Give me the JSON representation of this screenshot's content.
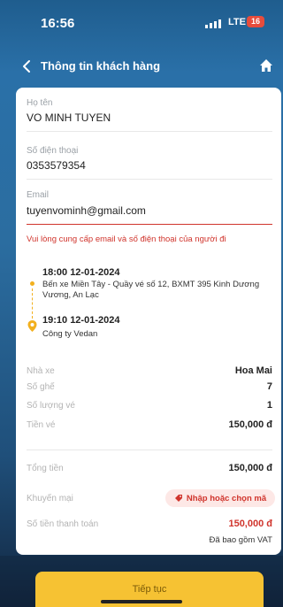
{
  "status_bar": {
    "time": "16:56",
    "network": "LTE",
    "battery": "16"
  },
  "nav": {
    "title": "Thông tin khách hàng"
  },
  "form": {
    "name_label": "Họ tên",
    "name_value": "VO MINH TUYEN",
    "phone_label": "Số điện thoại",
    "phone_value": "0353579354",
    "email_label": "Email",
    "email_value": "tuyenvominh@gmail.com",
    "warning": "Vui lòng cung cấp email và số điện thoại của người đi"
  },
  "trip": {
    "departure_time": "18:00 12-01-2024",
    "departure_address": "Bến xe Miền Tây - Quầy vé số 12, BXMT 395 Kinh Dương Vương, An Lạc",
    "arrival_time": "19:10 12-01-2024",
    "arrival_address": "Công ty Vedan"
  },
  "details": {
    "operator_label": "Nhà xe",
    "operator_value": "Hoa Mai",
    "seat_label": "Số ghế",
    "seat_value": "7",
    "ticket_count_label": "Số lượng vé",
    "ticket_count_value": "1",
    "ticket_price_label": "Tiền vé",
    "ticket_price_value": "150,000 đ"
  },
  "summary": {
    "total_label": "Tổng tiền",
    "total_value": "150,000 đ",
    "promo_label": "Khuyến mại",
    "promo_button": "Nhập hoặc chọn mã",
    "pay_label": "Số tiền thanh toán",
    "pay_value": "150,000 đ",
    "vat_note": "Đã bao gồm VAT"
  },
  "footer": {
    "continue_label": "Tiếp tục"
  },
  "colors": {
    "accent": "#f6c233",
    "warning": "#d0342c",
    "header": "#2a70a8"
  }
}
